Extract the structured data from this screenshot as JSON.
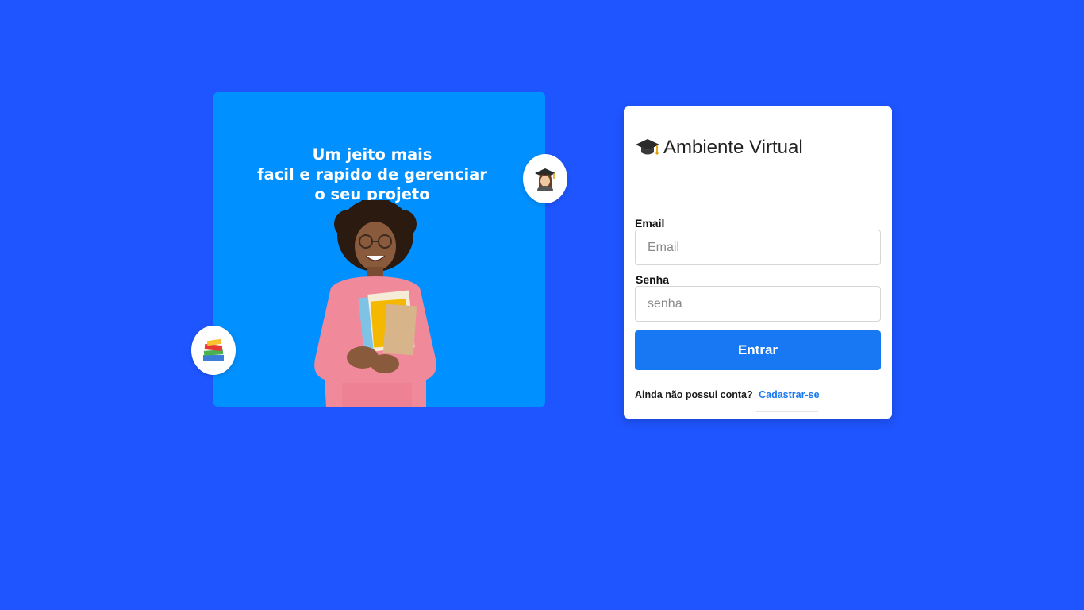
{
  "hero": {
    "title_lines": [
      "Um jeito mais",
      "facil e rapido de gerenciar",
      "o seu projeto"
    ],
    "background_color": "#0090ff",
    "badges": [
      "teacher-icon",
      "books-icon"
    ]
  },
  "page": {
    "background_color": "#1f55ff"
  },
  "login": {
    "title": "Ambiente Virtual",
    "title_icon": "graduation-cap-icon",
    "email": {
      "label": "Email",
      "placeholder": "Email",
      "value": ""
    },
    "password": {
      "label": "Senha",
      "placeholder": "senha",
      "value": ""
    },
    "submit_label": "Entrar",
    "submit_color": "#1877f2",
    "signup_prompt": "Ainda não possui conta?",
    "signup_link": "Cadastrar-se"
  }
}
